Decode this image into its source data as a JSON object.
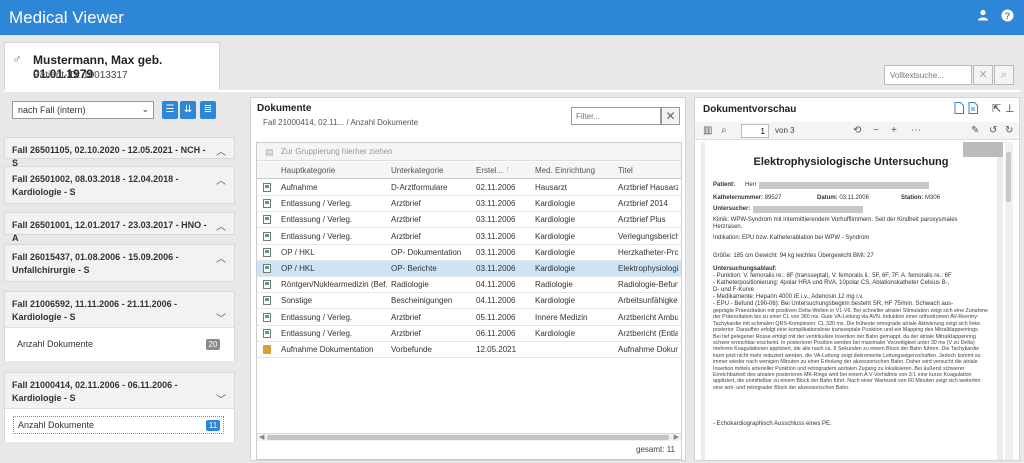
{
  "app": {
    "title": "Medical Viewer"
  },
  "patient": {
    "name": "Mustermann, Max geb. 01.01.1979",
    "id_label": "Patient-ID: 10013317"
  },
  "search": {
    "placeholder": "Volltextsuche..."
  },
  "left": {
    "grouping": "nach Fall (intern)",
    "cases": [
      {
        "title": "Fall 26501105, 02.10.2020 - 12.05.2021 - NCH - S"
      },
      {
        "title": "Fall 26501002, 08.03.2018 - 12.04.2018 - Kardiologie - S"
      },
      {
        "title": "Fall 26501001, 12.01.2017 - 23.03.2017 - HNO - A"
      },
      {
        "title": "Fall 26015437, 01.08.2006 - 15.09.2006 - Unfallchirurgie - S"
      },
      {
        "title": "Fall 21006592, 11.11.2006 - 21.11.2006 - Kardiologie - S",
        "count_label": "Anzahl Dokumente",
        "count": "20"
      },
      {
        "title": "Fall 21000414, 02.11.2006 - 06.11.2006 - Kardiologie - S",
        "count_label": "Anzahl Dokumente",
        "count": "11"
      }
    ]
  },
  "documents": {
    "title": "Dokumente",
    "subtitle": "Fall 21000414, 02.11... / Anzahl Dokumente",
    "filter_placeholder": "Filter...",
    "group_hint": "Zur Gruppierung hierher ziehen",
    "columns": [
      "Hauptkategorie",
      "Unterkategorie",
      "Erstel...",
      "Med. Einrichtung",
      "Titel"
    ],
    "rows": [
      [
        "Aufnahme",
        "D-Arztformulare",
        "02.11.2006",
        "Hausarzt",
        "Arztbrief Hausarzt"
      ],
      [
        "Entlassung / Verleg.",
        "Arztbrief",
        "03.11.2006",
        "Kardiologie",
        "Arztbrief 2014"
      ],
      [
        "Entlassung / Verleg.",
        "Arztbrief",
        "03.11.2006",
        "Kardiologie",
        "Arztbrief Plus"
      ],
      [
        "Entlassung / Verleg.",
        "Arztbrief",
        "03.11.2006",
        "Kardiologie",
        "Verlegungsbericht (vc"
      ],
      [
        "OP / HKL",
        "OP- Dokumentation",
        "03.11.2006",
        "Kardiologie",
        "Herzkatheter-Protokc"
      ],
      [
        "OP / HKL",
        "OP- Berichte",
        "03.11.2006",
        "Kardiologie",
        "Elektrophysiologische"
      ],
      [
        "Röntgen/Nuklearmedizin (Bef...",
        "Radiologie",
        "04.11.2006",
        "Radiologie",
        "Radiologie-Befund"
      ],
      [
        "Sonstige",
        "Bescheinigungen",
        "04.11.2006",
        "Kardiologie",
        "Arbeitsunfähigkeitsbe"
      ],
      [
        "Entlassung / Verleg.",
        "Arztbrief",
        "05.11.2006",
        "Innere Medizin",
        "Arztbericht Ambulant"
      ],
      [
        "Entlassung / Verleg.",
        "Arztbrief",
        "06.11.2006",
        "Kardiologie",
        "Arztbericht (Entlassb"
      ],
      [
        "Aufnahme Dokumentation",
        "Vorbefunde",
        "12.05.2021",
        "",
        "Aufnahme Dokumentation"
      ]
    ],
    "total": "gesamt: 11"
  },
  "preview": {
    "title": "Dokumentvorschau",
    "page": "1",
    "page_of": "von 3",
    "doc_title": "Elektrophysiologische Untersuchung",
    "lines": {
      "patient": "Patient:",
      "herr": "Herr",
      "kat_label": "Katheternummer:",
      "kat_val": "89527",
      "datum_label": "Datum:",
      "datum_val": "03.11.2006",
      "station_label": "Station:",
      "station_val": "M306",
      "unters": "Untersucher:",
      "klinik": "Klinik: WPW-Syndrom mit intermittierendem Vorhofflimmern. Seit der Kindheit paroxysmales",
      "klinik2": "Herzrasen.",
      "indik": "Indikation: EPU bzw. Katheterablation bei WPW - Syndrom",
      "groesse": "Größe: 185 cm   Gewicht: 94 kg   leichtes Übergewicht BMI: 27",
      "ablauf": "Untersuchungsablauf:",
      "punktion": "- Punktion: V. femoralis re.: 8F (transseptal), V. femoralis li.: 5F, 6F, 7F. A. femoralis re.: 6F",
      "kath": "- Katheterpositionierung: 4polar HRA und RVA, 10polar CS, Ablationskatheter Celsius B-,",
      "kath2": "D- und F-Kurve",
      "medik": "- Medikamente: Heparin 4000 IE i.v., Adenosin 12 mg i.v.",
      "epu": "- EPU - Befund (190-06): Bei Untersuchungsbeginn besteht SR, HF 75/min. Schwach aus-",
      "body": "geprägte Präexzitation mit positiven Delta-Wellen in V1-V6. Bei schneller atrialer Stimulation zeigt sich eine Zunahme der Präexzitation bis zu einer CL von 360 ms. Gute VA-Leitung via AVN. Induktion einer orthodromen AV-Reentry-Tachykardie mit schmalen QRS-Komplexen: CL 320 ms. Die früheste retrograde atriale Aktivierung zeigt sich linke posterior. Daraufhin erfolgt eine komplikationslose transseptale Punktion und ein Mapping des Mitralklappenrings. Bei tief gelegener Rosse erfolgt mit der ventrikuläre Insertion der Bahn gemappt, da der atriale Mitralklappenring schwer erreichbar erscheint. In posteriorer Position werden bei maximaler Vorzeitigkeit unter 30 ms (V zu Delta) mehrere Koagulationen appliziert, die alle nach ca. 8 Sekunden zu einem Block der Bahn führen. Die Tachykardie kann jetzt nicht mehr induziert werden, die VA-Leitung zeigt dekremente Leitungseigenschaften. Jedoch kommt es immer wieder nach wenigen Minuten zu einer Erholung der akzessorischen Bahn. Daher wird versucht die atriale Insertion mittels arterieller Punktion und retrogradem aortalen Zugang zu lokalisieren. Bei äußerst schwerer Erreichbarkeit des atrialen posterioren MK-Rings wird bei einem A:V-Verhältnis von 3:1 eine kurze Koagulation appliziert, die unmittelbar zu einem Block der Bahn führt. Nach einer Wartezeit von 60 Minuten zeigt sich weiterhin eine anti- und retrograder Block der akzessorischen Bahn.",
      "echo": "- Echokardiographisch Ausschluss eines PE."
    }
  },
  "colors": {
    "brand": "#2e86d6",
    "selected_row": "#cde4f6",
    "badge_gray": "#8a8a8a"
  }
}
